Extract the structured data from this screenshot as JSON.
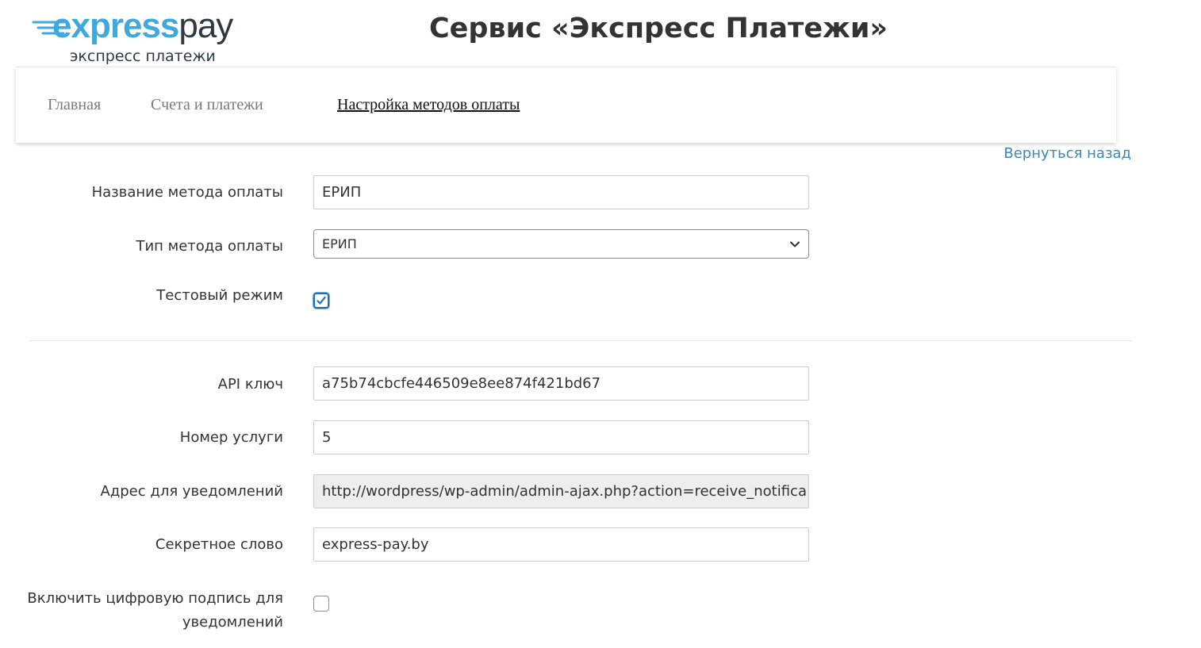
{
  "logo": {
    "word_part1": "express",
    "word_part2": "pay",
    "subtitle": "экспресс платежи",
    "colors": {
      "brand_blue": "#3fa9dd",
      "dark": "#2d3a44"
    }
  },
  "page_title": "Сервис «Экспресс Платежи»",
  "nav": {
    "items": [
      {
        "label": "Главная",
        "active": false
      },
      {
        "label": "Счета и платежи",
        "active": false
      },
      {
        "label": "Настройка методов оплаты",
        "active": true
      }
    ]
  },
  "back_link": "Вернуться назад",
  "form": {
    "method_name": {
      "label": "Название метода оплаты",
      "value": "ЕРИП"
    },
    "method_type": {
      "label": "Тип метода оплаты",
      "selected": "ЕРИП"
    },
    "test_mode": {
      "label": "Тестовый режим",
      "checked": true
    },
    "api_key": {
      "label": "API ключ",
      "value": "a75b74cbcfe446509e8ee874f421bd67"
    },
    "service_number": {
      "label": "Номер услуги",
      "value": "5"
    },
    "notify_url": {
      "label": "Адрес для уведомлений",
      "value": "http://wordpress/wp-admin/admin-ajax.php?action=receive_notifica"
    },
    "secret_word": {
      "label": "Секретное слово",
      "value": "express-pay.by"
    },
    "digital_signature": {
      "label": "Включить цифровую подпись для уведомлений",
      "checked": false
    }
  },
  "colors": {
    "link": "#3a87b8",
    "checkbox_accent": "#2271b1",
    "readonly_bg": "#eeeeee"
  }
}
